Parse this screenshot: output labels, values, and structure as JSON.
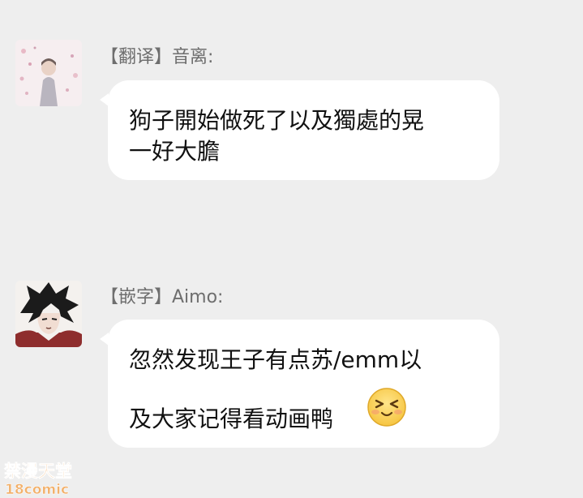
{
  "messages": [
    {
      "sender": "【翻译】音离:",
      "lines": [
        "狗子開始做死了以及獨處的晃",
        "一好大膽"
      ]
    },
    {
      "sender": "【嵌字】Aimo:",
      "lines": [
        "忽然发现王子有点苏/emm以",
        "及大家记得看动画鸭"
      ],
      "emoji": "grinning-squint-face-emoji"
    }
  ],
  "watermark": {
    "line1": "禁漫天堂",
    "line2": "18comic"
  },
  "colors": {
    "background": "#eeeeee",
    "bubble": "#ffffff",
    "sender_text": "#6e6e6e",
    "message_text": "#111111",
    "watermark": "#f2b06a"
  }
}
